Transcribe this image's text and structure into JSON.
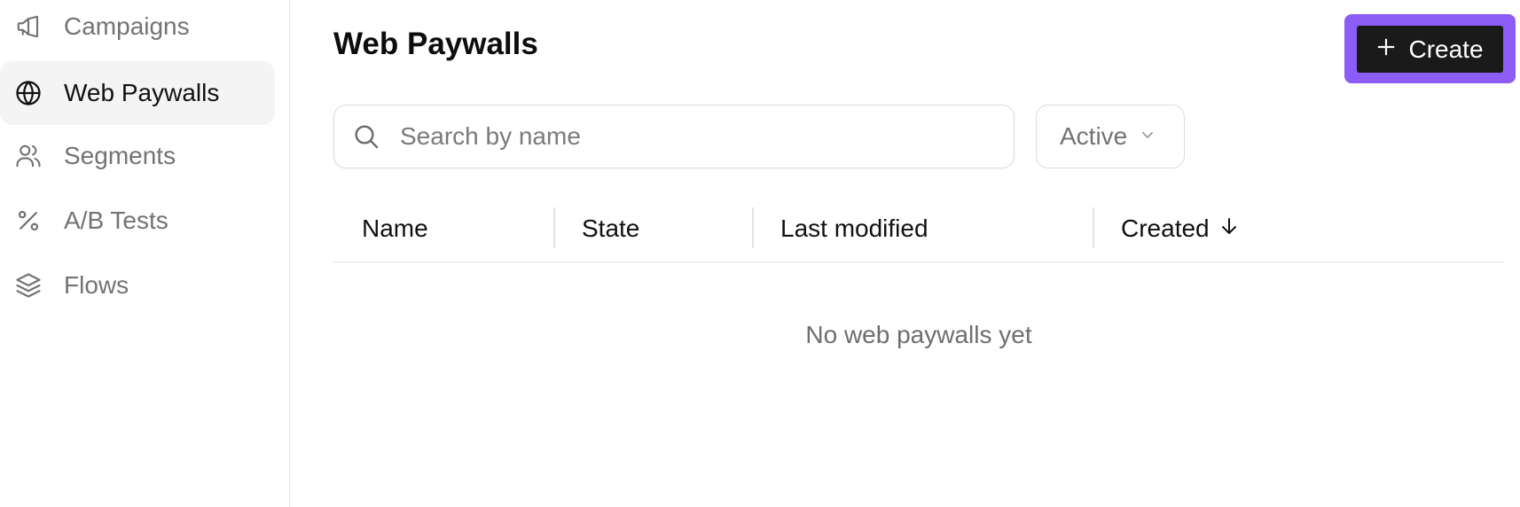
{
  "sidebar": {
    "items": [
      {
        "label": "Campaigns",
        "icon": "megaphone-icon",
        "active": false
      },
      {
        "label": "Web Paywalls",
        "icon": "globe-icon",
        "active": true
      },
      {
        "label": "Segments",
        "icon": "users-icon",
        "active": false
      },
      {
        "label": "A/B Tests",
        "icon": "percent-icon",
        "active": false
      },
      {
        "label": "Flows",
        "icon": "layers-icon",
        "active": false
      }
    ]
  },
  "header": {
    "title": "Web Paywalls",
    "create_label": "Create",
    "create_icon": "plus-icon"
  },
  "search": {
    "placeholder": "Search by name",
    "value": ""
  },
  "filter": {
    "selected": "Active",
    "icon": "chevron-down-icon"
  },
  "table": {
    "columns": [
      {
        "label": "Name"
      },
      {
        "label": "State"
      },
      {
        "label": "Last modified"
      },
      {
        "label": "Created",
        "sort": "descending",
        "sort_icon": "arrow-down-icon"
      }
    ],
    "rows": [],
    "empty_message": "No web paywalls yet"
  },
  "colors": {
    "accent": "#8b5cf6",
    "button_bg": "#1a1a1a",
    "active_item_bg": "#f4f4f4",
    "muted_text": "#737373"
  }
}
